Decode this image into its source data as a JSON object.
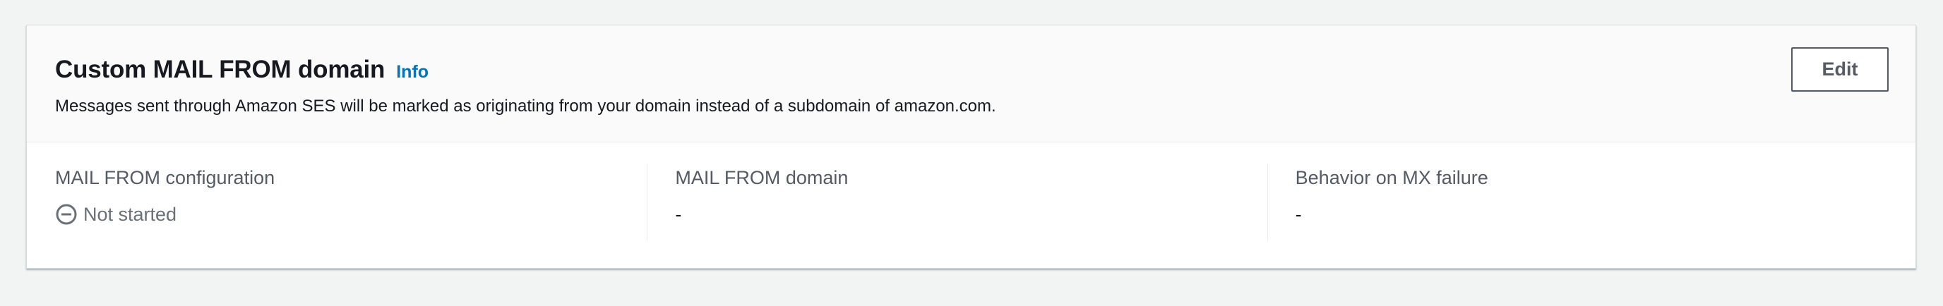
{
  "panel": {
    "title": "Custom MAIL FROM domain",
    "info_link": "Info",
    "description": "Messages sent through Amazon SES will be marked as originating from your domain instead of a subdomain of amazon.com.",
    "edit_label": "Edit"
  },
  "fields": [
    {
      "label": "MAIL FROM configuration",
      "value": "Not started",
      "icon": "status-stopped-icon"
    },
    {
      "label": "MAIL FROM domain",
      "value": "-"
    },
    {
      "label": "Behavior on MX failure",
      "value": "-"
    }
  ],
  "colors": {
    "page_bg": "#f2f3f3",
    "link": "#0073bb",
    "status_grey": "#687078",
    "border": "#eaeded"
  }
}
